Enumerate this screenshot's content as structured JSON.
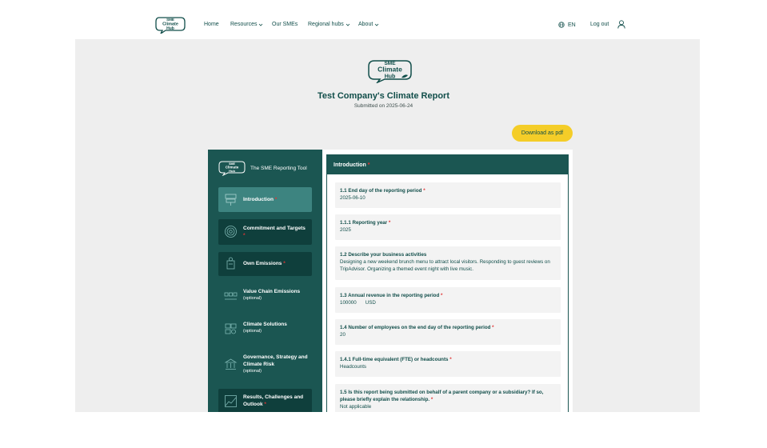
{
  "nav": {
    "logo_text": [
      "SME",
      "Climate",
      "Hub"
    ],
    "items": [
      {
        "label": "Home",
        "dropdown": false
      },
      {
        "label": "Resources",
        "dropdown": true
      },
      {
        "label": "Our SMEs",
        "dropdown": false
      },
      {
        "label": "Regional hubs",
        "dropdown": true
      },
      {
        "label": "About",
        "dropdown": true
      }
    ],
    "language": "EN",
    "logout": "Log out",
    "icons": {
      "language": "globe-icon",
      "user": "user-icon",
      "dropdown": "chevron-down-icon"
    }
  },
  "report": {
    "title": "Test Company's Climate Report",
    "submitted": "Submitted on 2025-06-24",
    "download_label": "Download as pdf"
  },
  "sidebar": {
    "title": "The SME Reporting Tool",
    "items": [
      {
        "label": "Introduction",
        "sub": "",
        "required": true,
        "icon": "signpost-icon",
        "state": "active"
      },
      {
        "label": "Commitment and Targets",
        "sub": "",
        "required": true,
        "icon": "target-icon",
        "state": "dark"
      },
      {
        "label": "Own Emissions",
        "sub": "",
        "required": true,
        "icon": "factory-icon",
        "state": "dark"
      },
      {
        "label": "Value Chain Emissions",
        "sub": "(optional)",
        "required": false,
        "icon": "truck-chain-icon",
        "state": "normal"
      },
      {
        "label": "Climate Solutions",
        "sub": "(optional)",
        "required": false,
        "icon": "solutions-icon",
        "state": "normal"
      },
      {
        "label": "Governance, Strategy and Climate Risk",
        "sub": "(optional)",
        "required": false,
        "icon": "governance-icon",
        "state": "normal"
      },
      {
        "label": "Results, Challenges and Outlook",
        "sub": "",
        "required": true,
        "icon": "chart-icon",
        "state": "dark"
      }
    ]
  },
  "section": {
    "title": "Introduction",
    "required_mark": "*",
    "fields": [
      {
        "label": "1.1 End day of the reporting period",
        "required": true,
        "value": "2025-06-10"
      },
      {
        "label": "1.1.1 Reporting year",
        "required": true,
        "value": "2025"
      },
      {
        "label": "1.2 Describe your business activities",
        "required": false,
        "value": "Designing a new weekend brunch menu to attract local visitors. Responding to guest reviews on TripAdvisor. Organizing a themed event night with live music."
      },
      {
        "label": "1.3 Annual revenue in the reporting period",
        "required": true,
        "value": "100000   USD"
      },
      {
        "label": "1.4 Number of employees on the end day of the reporting period",
        "required": true,
        "value": "20"
      },
      {
        "label": "1.4.1 Full-time equivalent (FTE) or headcounts",
        "required": true,
        "value": "Headcounts"
      },
      {
        "label": "1.5 Is this report being submitted on behalf of a parent company or a subsidiary? If so, please briefly explain the relationship.",
        "required": true,
        "value": "Not applicable"
      }
    ]
  },
  "colors": {
    "primary": "#1b5652",
    "active": "#3d8480",
    "dark_item": "#0f3f3c",
    "accent": "#f4cd28",
    "required": "#e03434"
  }
}
